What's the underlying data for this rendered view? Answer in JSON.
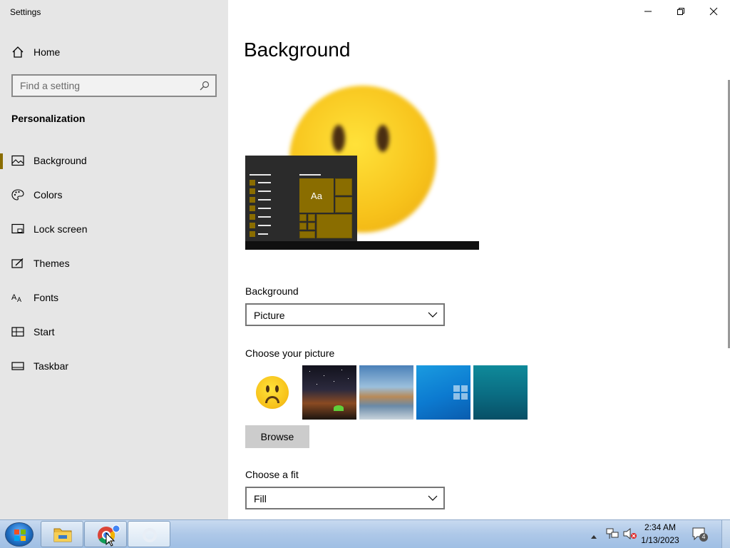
{
  "app": {
    "title": "Settings"
  },
  "sidebar": {
    "home_label": "Home",
    "search_placeholder": "Find a setting",
    "section_title": "Personalization",
    "items": [
      {
        "label": "Background",
        "icon": "picture-icon",
        "active": true
      },
      {
        "label": "Colors",
        "icon": "palette-icon",
        "active": false
      },
      {
        "label": "Lock screen",
        "icon": "lock-screen-icon",
        "active": false
      },
      {
        "label": "Themes",
        "icon": "themes-icon",
        "active": false
      },
      {
        "label": "Fonts",
        "icon": "fonts-icon",
        "active": false
      },
      {
        "label": "Start",
        "icon": "start-icon",
        "active": false
      },
      {
        "label": "Taskbar",
        "icon": "taskbar-icon",
        "active": false
      }
    ]
  },
  "main": {
    "title": "Background",
    "preview": {
      "tile_text": "Aa"
    },
    "background_label": "Background",
    "background_value": "Picture",
    "choose_picture_label": "Choose your picture",
    "browse_label": "Browse",
    "fit_label": "Choose a fit",
    "fit_value": "Fill"
  },
  "taskbar": {
    "time": "2:34 AM",
    "date": "1/13/2023",
    "notification_count": "4"
  },
  "colors": {
    "accent": "#8a6d00",
    "sidebar_bg": "#e6e6e6",
    "taskbar_bg": "#aec8e8"
  }
}
